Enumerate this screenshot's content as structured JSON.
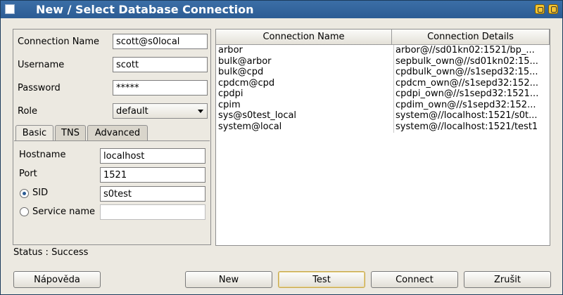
{
  "window": {
    "title": "New / Select Database Connection"
  },
  "form": {
    "connection_name_label": "Connection Name",
    "connection_name_value": "scott@s0local",
    "username_label": "Username",
    "username_value": "scott",
    "password_label": "Password",
    "password_value": "*****",
    "role_label": "Role",
    "role_value": "default"
  },
  "tabs": [
    {
      "label": "Basic",
      "active": true
    },
    {
      "label": "TNS",
      "active": false
    },
    {
      "label": "Advanced",
      "active": false
    }
  ],
  "basic": {
    "hostname_label": "Hostname",
    "hostname_value": "localhost",
    "port_label": "Port",
    "port_value": "1521",
    "sid_label": "SID",
    "sid_value": "s0test",
    "sid_selected": true,
    "service_name_label": "Service name",
    "service_name_value": ""
  },
  "table": {
    "columns": [
      "Connection Name",
      "Connection Details"
    ],
    "rows": [
      {
        "name": "arbor",
        "details": "arbor@//sd01kn02:1521/bp_..."
      },
      {
        "name": "bulk@arbor",
        "details": "sepbulk_own@//sd01kn02:15..."
      },
      {
        "name": "bulk@cpd",
        "details": "cpdbulk_own@//s1sepd32:15..."
      },
      {
        "name": "cpdcm@cpd",
        "details": "cpdcm_own@//s1sepd32:152..."
      },
      {
        "name": "cpdpi",
        "details": "cpdpi_own@//s1sepd32:1521..."
      },
      {
        "name": "cpim",
        "details": "cpdim_own@//s1sepd32:152..."
      },
      {
        "name": "sys@s0test_local",
        "details": "system@//localhost:1521/s0t..."
      },
      {
        "name": "system@local",
        "details": "system@//localhost:1521/test1"
      }
    ]
  },
  "status": {
    "text": "Status : Success"
  },
  "buttons": {
    "help": "Nápověda",
    "new": "New",
    "test": "Test",
    "connect": "Connect",
    "cancel": "Zrušit"
  }
}
